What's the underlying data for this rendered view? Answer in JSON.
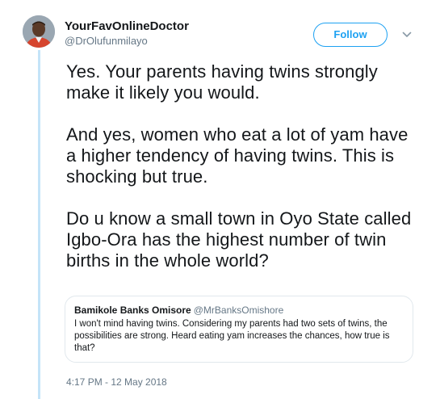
{
  "tweet": {
    "author": {
      "display_name": "YourFavOnlineDoctor",
      "handle": "@DrOlufunmilayo"
    },
    "follow_label": "Follow",
    "paragraphs": [
      "Yes. Your parents having twins strongly make it likely you would.",
      "And yes, women who eat a lot of yam have a higher tendency of having twins. This is shocking but true.",
      "Do u know a small town in Oyo State called Igbo-Ora has the highest number of twin births in the whole world?"
    ],
    "quoted": {
      "display_name": "Bamikole Banks Omisore",
      "handle": "@MrBanksOmishore",
      "text": "I won't mind having twins. Considering my parents had two sets of twins, the possibilities are strong. Heard eating yam increases the chances, how true is that?"
    },
    "timestamp": "4:17 PM - 12 May 2018"
  },
  "colors": {
    "accent": "#1da1f2",
    "thread_line": "#c4e4f8",
    "secondary_text": "#657786",
    "border": "#e1e8ed"
  },
  "icons": {
    "more": "chevron-down-icon"
  }
}
